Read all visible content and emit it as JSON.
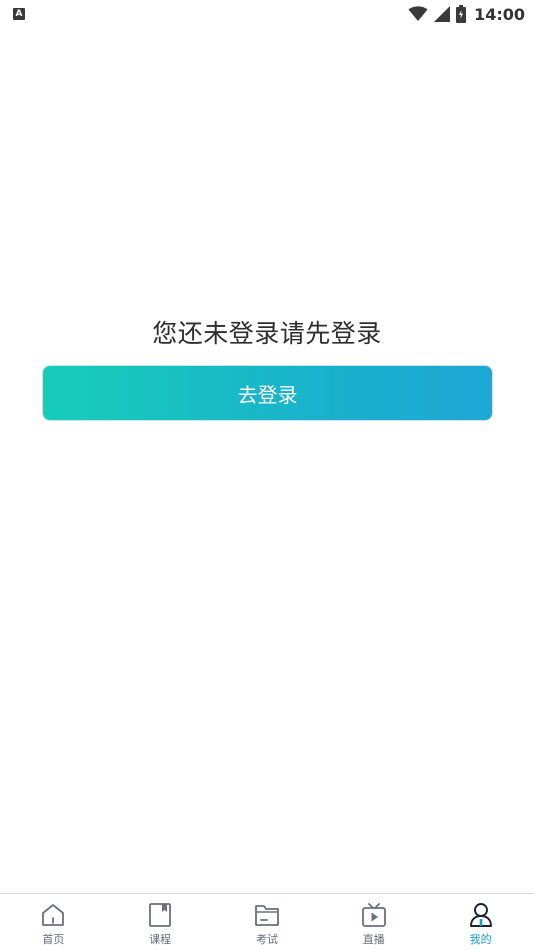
{
  "status_bar": {
    "notification_icon": "A",
    "time": "14:00",
    "icons": [
      "wifi-icon",
      "signal-icon",
      "battery-icon"
    ]
  },
  "main": {
    "prompt": "您还未登录请先登录",
    "login_button": "去登录"
  },
  "bottom_nav": {
    "items": [
      {
        "label": "首页",
        "icon": "home-icon",
        "active": false
      },
      {
        "label": "课程",
        "icon": "book-icon",
        "active": false
      },
      {
        "label": "考试",
        "icon": "folder-icon",
        "active": false
      },
      {
        "label": "直播",
        "icon": "tv-icon",
        "active": false
      },
      {
        "label": "我的",
        "icon": "user-icon",
        "active": true
      }
    ],
    "active_color": "#1e9bd6",
    "inactive_color": "#666a7a"
  },
  "colors": {
    "button_gradient_start": "#17cdb9",
    "button_gradient_end": "#1ea7d6"
  }
}
